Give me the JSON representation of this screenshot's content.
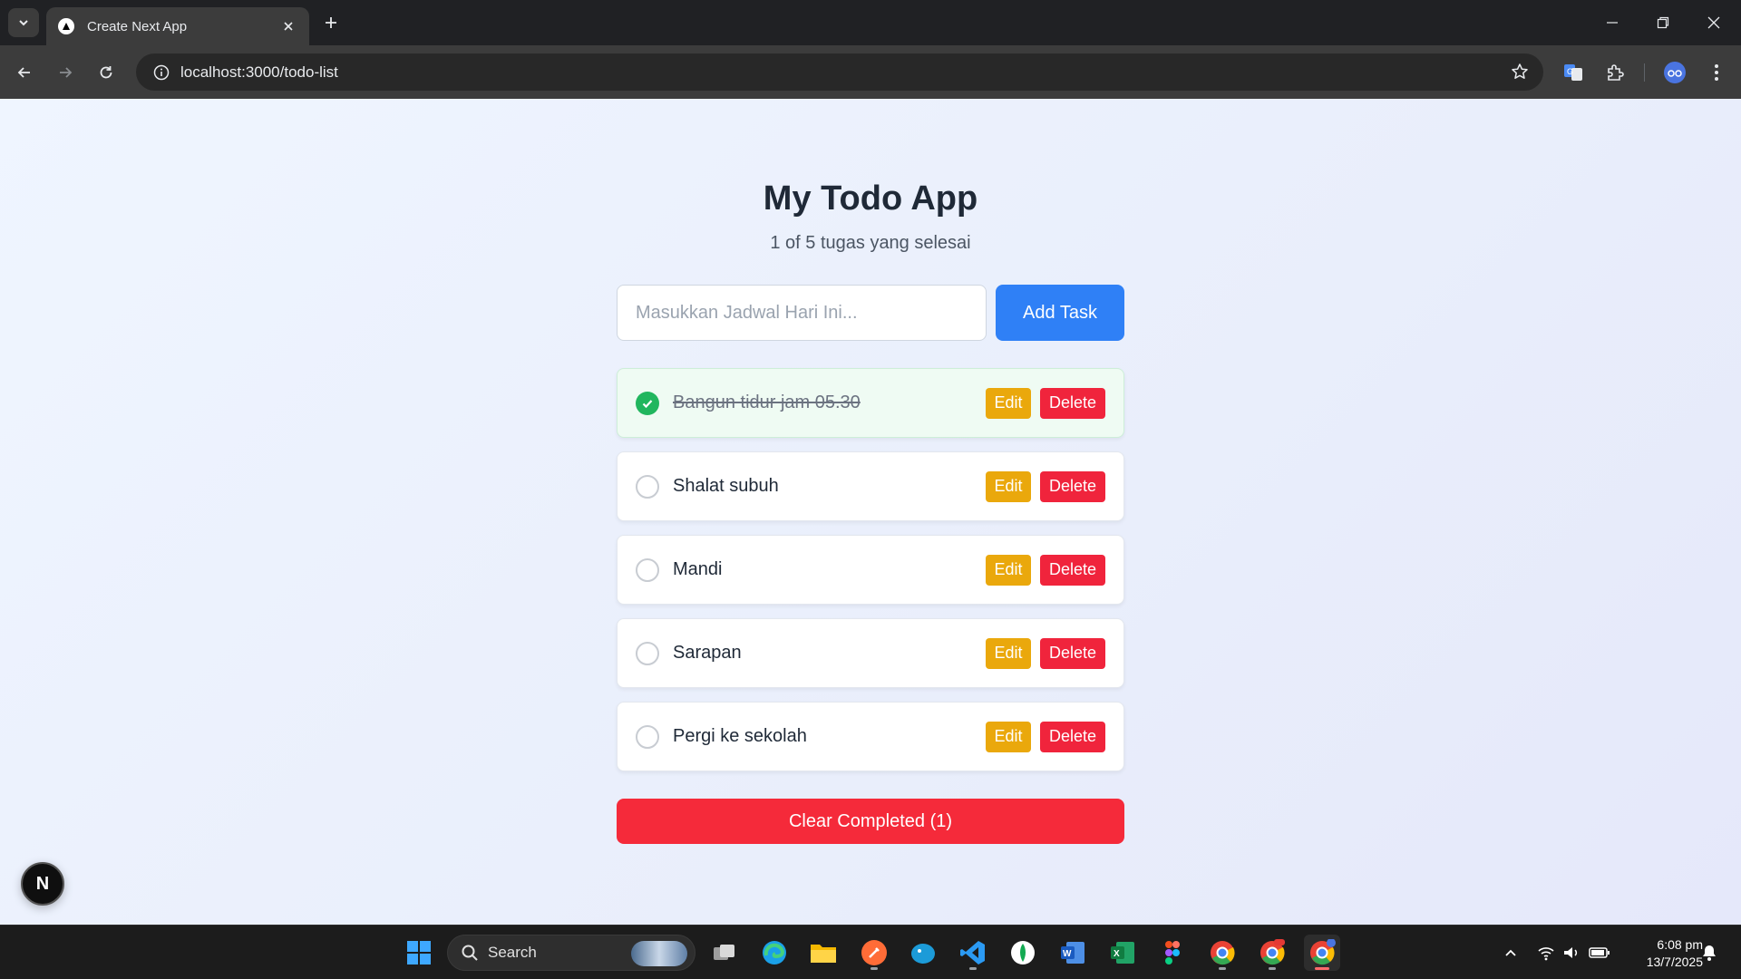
{
  "browser": {
    "tab_title": "Create Next App",
    "url": "localhost:3000/todo-list"
  },
  "app": {
    "title": "My Todo App",
    "subtitle": "1 of 5 tugas yang selesai",
    "input": {
      "placeholder": "Masukkan Jadwal Hari Ini...",
      "value": ""
    },
    "add_button": "Add Task",
    "edit_label": "Edit",
    "delete_label": "Delete",
    "todos": [
      {
        "text": "Bangun tidur jam 05.30",
        "completed": true
      },
      {
        "text": "Shalat subuh",
        "completed": false
      },
      {
        "text": "Mandi",
        "completed": false
      },
      {
        "text": "Sarapan",
        "completed": false
      },
      {
        "text": "Pergi ke sekolah",
        "completed": false
      }
    ],
    "clear_button": "Clear Completed (1)",
    "dev_badge": "N"
  },
  "taskbar": {
    "search_label": "Search",
    "clock_time": "6:08 pm",
    "clock_date": "13/7/2025"
  },
  "colors": {
    "accent": "#2f80f6",
    "edit": "#eaa80c",
    "delete": "#f0243c",
    "complete": "#21b65e"
  }
}
